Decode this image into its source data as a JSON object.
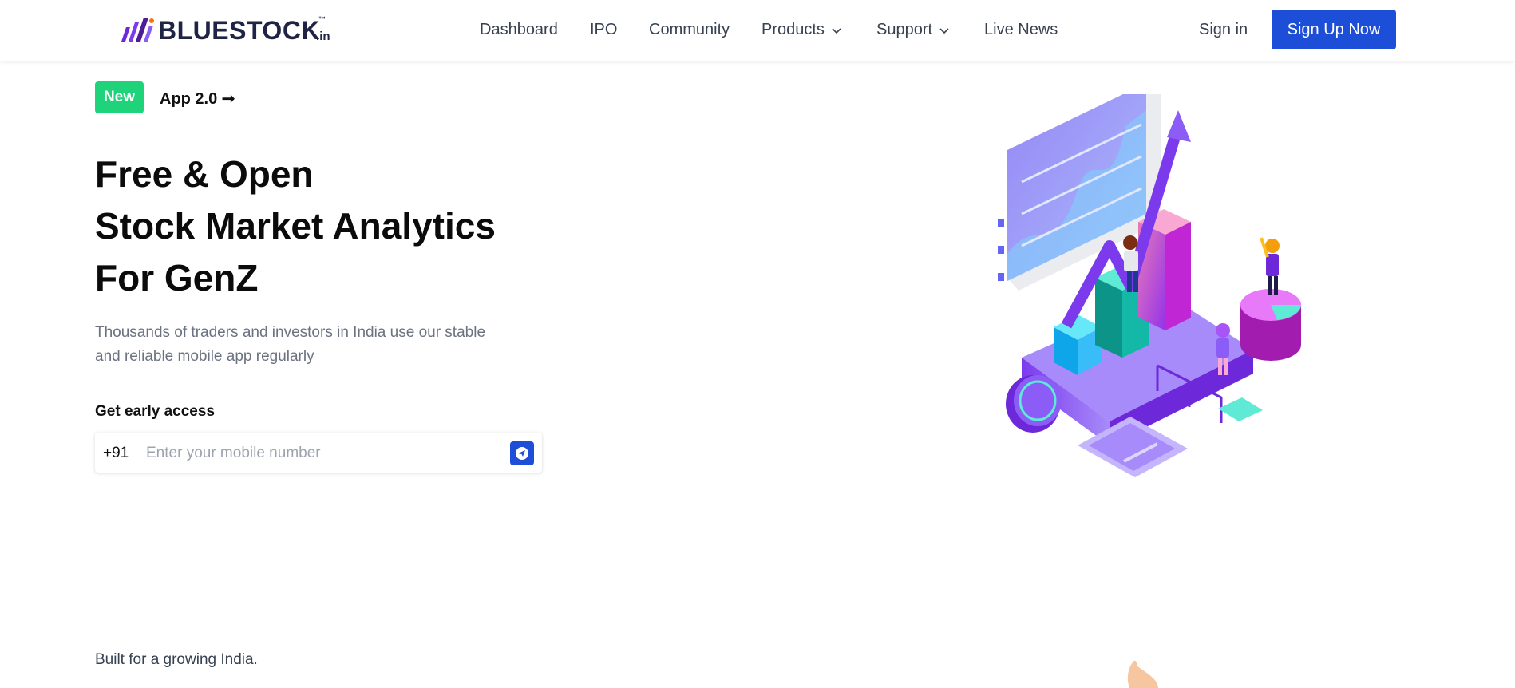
{
  "brand": {
    "name": "BLUESTOCK",
    "tm": "™",
    "suffix": ".in",
    "colors": {
      "primary": "#1d4ed8",
      "badge": "#1fd37a",
      "logo_mark": "#6d28d9"
    }
  },
  "nav": {
    "items": [
      {
        "label": "Dashboard"
      },
      {
        "label": "IPO"
      },
      {
        "label": "Community"
      },
      {
        "label": "Products",
        "icon": "chevron-down-icon"
      },
      {
        "label": "Support",
        "icon": "chevron-down-icon"
      },
      {
        "label": "Live News"
      }
    ],
    "signin_label": "Sign in",
    "signup_label": "Sign Up Now"
  },
  "hero": {
    "badge": "New",
    "badge_link": "App 2.0 ➞",
    "headline": [
      "Free & Open",
      "Stock Market Analytics",
      "For GenZ"
    ],
    "subtext": "Thousands of traders and investors in India use our stable and reliable mobile app regularly",
    "early_access_label": "Get early access",
    "phone": {
      "country_code": "+91",
      "placeholder": "Enter your mobile number",
      "value": "",
      "submit_icon": "send-icon"
    },
    "illustration_icon": "stock-analytics-illustration"
  },
  "footer_teaser": {
    "text": "Built for a growing India."
  }
}
